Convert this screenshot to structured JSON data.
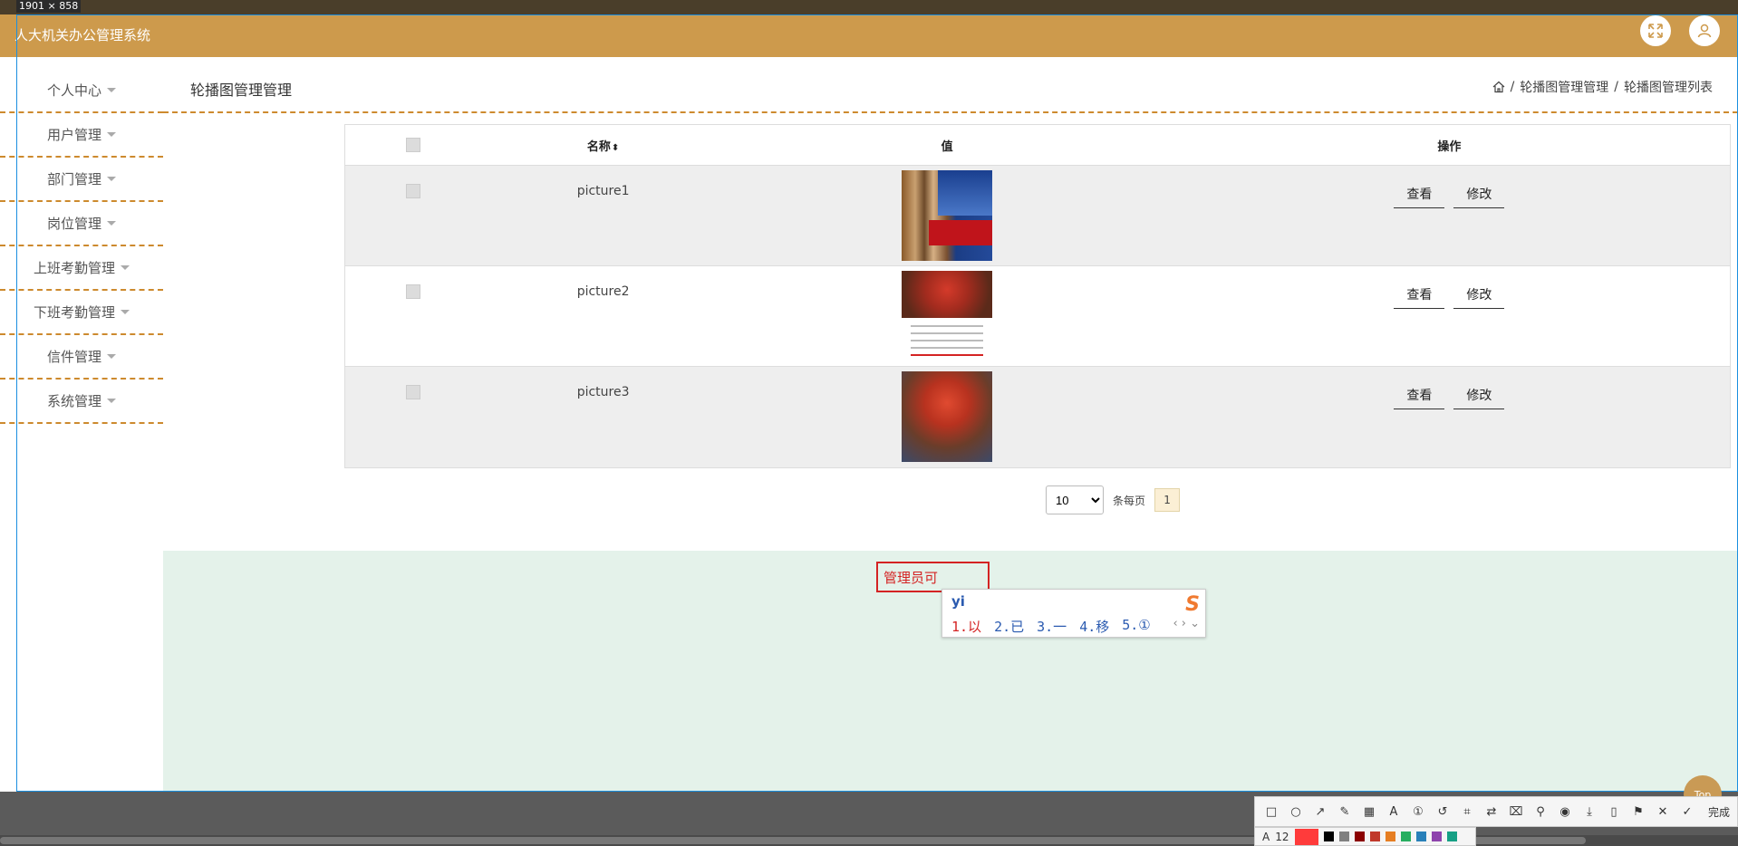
{
  "capture": {
    "size_label": "1901 × 858"
  },
  "header": {
    "app_title": "人大机关办公管理系统"
  },
  "sidebar": {
    "items": [
      {
        "label": "个人中心"
      },
      {
        "label": "用户管理"
      },
      {
        "label": "部门管理"
      },
      {
        "label": "岗位管理"
      },
      {
        "label": "上班考勤管理"
      },
      {
        "label": "下班考勤管理"
      },
      {
        "label": "信件管理"
      },
      {
        "label": "系统管理"
      }
    ]
  },
  "page": {
    "title": "轮播图管理管理",
    "breadcrumb": [
      "轮播图管理管理",
      "轮播图管理列表"
    ],
    "breadcrumb_sep": "/"
  },
  "table": {
    "columns": {
      "name": "名称",
      "value": "值",
      "actions": "操作"
    },
    "rows": [
      {
        "name": "picture1"
      },
      {
        "name": "picture2"
      },
      {
        "name": "picture3"
      }
    ],
    "view_label": "查看",
    "edit_label": "修改"
  },
  "pagination": {
    "page_size": "10",
    "page_size_options": [
      "10"
    ],
    "per_page_label": "条每页",
    "current_page": "1"
  },
  "footer": {
    "text": "管理员可",
    "ime_input": "yi",
    "ime_candidates": [
      "1.以",
      "2.已",
      "3.一",
      "4.移",
      "5.①"
    ]
  },
  "top_button": "Top",
  "toolbar": {
    "done_label": "完成",
    "font_size": "12",
    "colors": [
      "#000000",
      "#808080",
      "#8b0000",
      "#c0392b",
      "#e67e22",
      "#27ae60",
      "#2980b9",
      "#8e44ad",
      "#16a085"
    ]
  }
}
